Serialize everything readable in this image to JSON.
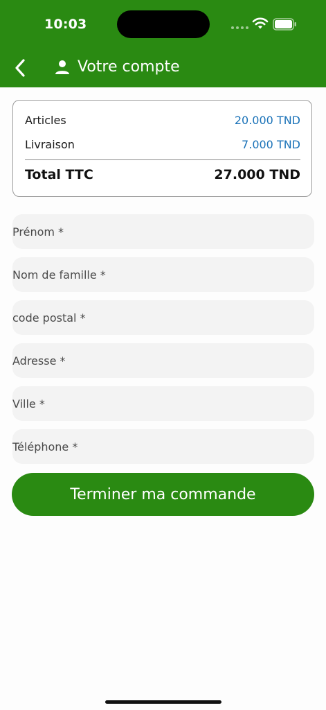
{
  "status": {
    "time": "10:03"
  },
  "header": {
    "title": "Votre compte",
    "back_icon": "chevron-left-icon",
    "user_icon": "user-icon"
  },
  "summary": {
    "articles_label": "Articles",
    "articles_value": "20.000 TND",
    "livraison_label": "Livraison",
    "livraison_value": "7.000 TND",
    "total_label": "Total TTC",
    "total_value": "27.000 TND"
  },
  "form": {
    "fields": [
      {
        "placeholder": "Prénom *",
        "value": ""
      },
      {
        "placeholder": "Nom de famille *",
        "value": ""
      },
      {
        "placeholder": "code postal *",
        "value": ""
      },
      {
        "placeholder": "Adresse *",
        "value": ""
      },
      {
        "placeholder": "Ville *",
        "value": ""
      },
      {
        "placeholder": "Téléphone *",
        "value": ""
      }
    ],
    "submit_label": "Terminer ma commande"
  },
  "colors": {
    "primary": "#2a8a12",
    "price_blue": "#1a72b8",
    "field_bg": "#f3f3f3"
  }
}
